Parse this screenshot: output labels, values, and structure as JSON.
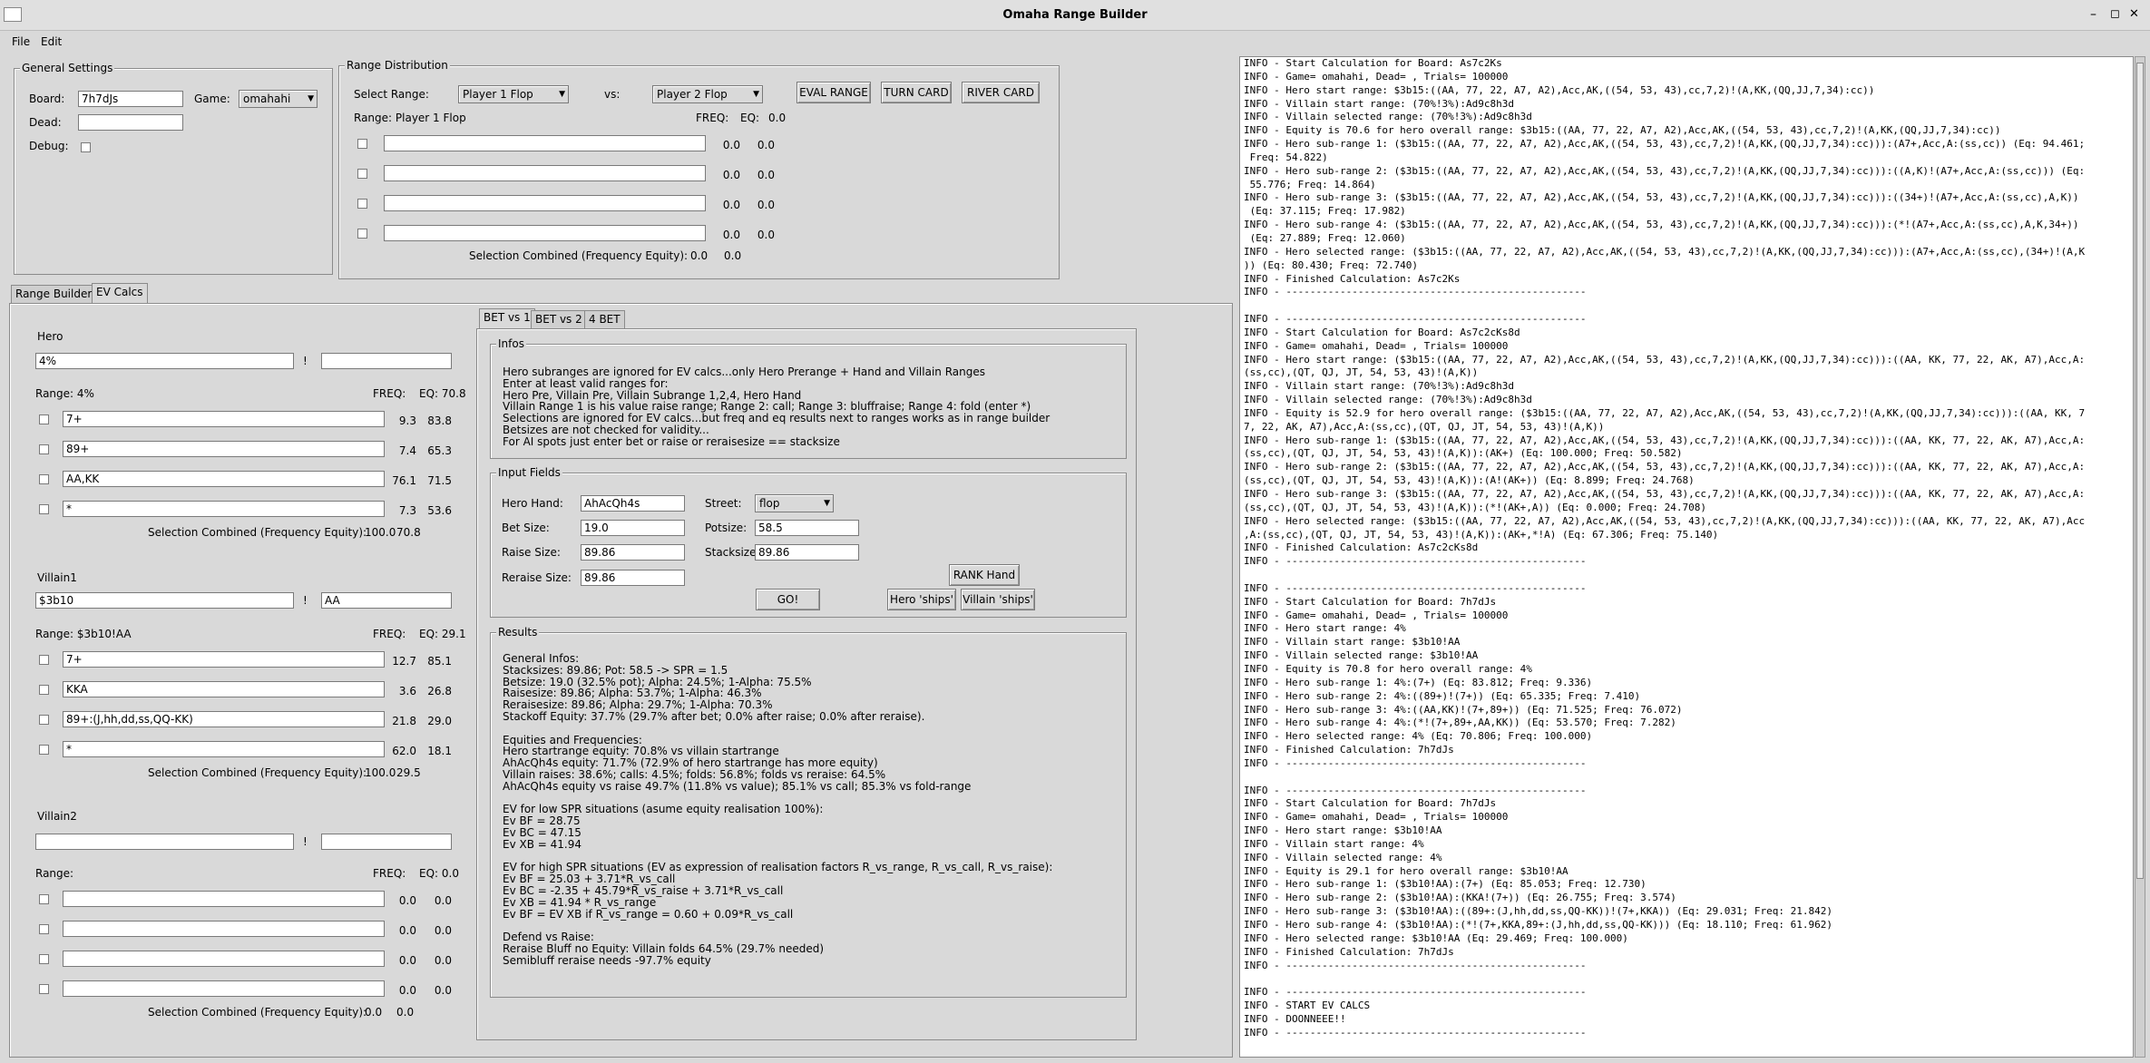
{
  "window": {
    "title": "Omaha Range Builder",
    "minimize": "–",
    "maximize": "◻",
    "close": "✕"
  },
  "menu": {
    "file": "File",
    "edit": "Edit"
  },
  "general": {
    "title": "General Settings",
    "board_label": "Board:",
    "board_value": "7h7dJs",
    "game_label": "Game:",
    "game_value": "omahahi",
    "dead_label": "Dead:",
    "dead_value": "",
    "debug_label": "Debug:"
  },
  "dist": {
    "title": "Range Distribution",
    "select_label": "Select Range:",
    "select_value": "Player 1 Flop",
    "vs_label": "vs:",
    "vs_value": "Player 2 Flop",
    "eval": "EVAL RANGE",
    "turn": "TURN CARD",
    "river": "RIVER CARD",
    "range_label": "Range: Player 1 Flop",
    "freq_label": "FREQ:",
    "eq_label": "EQ:",
    "eq_value": "0.0",
    "rows": [
      {
        "freq": "0.0",
        "eq": "0.0"
      },
      {
        "freq": "0.0",
        "eq": "0.0"
      },
      {
        "freq": "0.0",
        "eq": "0.0"
      },
      {
        "freq": "0.0",
        "eq": "0.0"
      }
    ],
    "combined_label": "Selection Combined (Frequency Equity):",
    "combined_freq": "0.0",
    "combined_eq": "0.0"
  },
  "tabs": {
    "range_builder": "Range Builder",
    "ev_calcs": "EV Calcs"
  },
  "hero": {
    "title": "Hero",
    "range_value": "4%",
    "bang": "!",
    "dead_value": "",
    "range_label": "Range: 4%",
    "freq_label": "FREQ:",
    "eq_label": "EQ: 70.8",
    "rows": [
      {
        "text": "7+",
        "freq": "9.3",
        "eq": "83.8"
      },
      {
        "text": "89+",
        "freq": "7.4",
        "eq": "65.3"
      },
      {
        "text": "AA,KK",
        "freq": "76.1",
        "eq": "71.5"
      },
      {
        "text": "*",
        "freq": "7.3",
        "eq": "53.6"
      }
    ],
    "combined_label": "Selection Combined (Frequency Equity):",
    "combined_freq": "100.0",
    "combined_eq": "70.8"
  },
  "villain1": {
    "title": "Villain1",
    "range_value": "$3b10",
    "bang": "!",
    "dead_value": "AA",
    "range_label": "Range: $3b10!AA",
    "freq_label": "FREQ:",
    "eq_label": "EQ: 29.1",
    "rows": [
      {
        "text": "7+",
        "freq": "12.7",
        "eq": "85.1"
      },
      {
        "text": "KKA",
        "freq": "3.6",
        "eq": "26.8"
      },
      {
        "text": "89+:(J,hh,dd,ss,QQ-KK)",
        "freq": "21.8",
        "eq": "29.0"
      },
      {
        "text": "*",
        "freq": "62.0",
        "eq": "18.1"
      }
    ],
    "combined_label": "Selection Combined (Frequency Equity):",
    "combined_freq": "100.0",
    "combined_eq": "29.5"
  },
  "villain2": {
    "title": "Villain2",
    "range_value": "",
    "bang": "!",
    "dead_value": "",
    "range_label": "Range:",
    "freq_label": "FREQ:",
    "eq_label": "EQ: 0.0",
    "rows": [
      {
        "text": "",
        "freq": "0.0",
        "eq": "0.0"
      },
      {
        "text": "",
        "freq": "0.0",
        "eq": "0.0"
      },
      {
        "text": "",
        "freq": "0.0",
        "eq": "0.0"
      },
      {
        "text": "",
        "freq": "0.0",
        "eq": "0.0"
      }
    ],
    "combined_label": "Selection Combined (Frequency Equity):",
    "combined_freq": "0.0",
    "combined_eq": "0.0"
  },
  "bet_tabs": {
    "bet1": "BET vs 1",
    "bet2": "BET vs 2",
    "bet4": "4 BET"
  },
  "infos": {
    "title": "Infos",
    "lines": [
      "Hero subranges are ignored for EV calcs...only Hero Prerange + Hand and Villain Ranges",
      "Enter at least valid ranges for:",
      "Hero Pre, Villain Pre, Villain Subrange 1,2,4, Hero Hand",
      "Villain Range 1 is his value raise range; Range 2: call; Range 3: bluffraise; Range 4: fold (enter *)",
      "Selections are ignored for EV calcs...but freq and eq results next to ranges works as in range builder",
      "Betsizes are not checked for validity...",
      "For AI spots just enter bet or raise or reraisesize == stacksize"
    ]
  },
  "inputs": {
    "title": "Input Fields",
    "hero_hand_label": "Hero Hand:",
    "hero_hand": "AhAcQh4s",
    "street_label": "Street:",
    "street": "flop",
    "bet_label": "Bet Size:",
    "bet": "19.0",
    "pot_label": "Potsize:",
    "pot": "58.5",
    "raise_label": "Raise Size:",
    "raise": "89.86",
    "stack_label": "Stacksize:",
    "stack": "89.86",
    "reraise_label": "Reraise Size:",
    "reraise": "89.86",
    "rank": "RANK Hand",
    "go": "GO!",
    "hero_ships": "Hero 'ships'",
    "villain_ships": "Villain 'ships'"
  },
  "results": {
    "title": "Results",
    "lines": [
      "General Infos:",
      "Stacksizes: 89.86; Pot: 58.5 -> SPR = 1.5",
      "Betsize: 19.0 (32.5% pot); Alpha: 24.5%; 1-Alpha: 75.5%",
      "Raisesize: 89.86; Alpha: 53.7%; 1-Alpha: 46.3%",
      "Reraisesize: 89.86; Alpha: 29.7%; 1-Alpha: 70.3%",
      "Stackoff Equity: 37.7% (29.7% after bet; 0.0% after raise; 0.0% after reraise).",
      "",
      "Equities and Frequencies:",
      "Hero startrange equity: 70.8% vs villain startrange",
      "AhAcQh4s equity: 71.7% (72.9% of hero startrange has more equity)",
      "Villain raises: 38.6%; calls: 4.5%; folds: 56.8%; folds vs reraise: 64.5%",
      "AhAcQh4s equity vs raise 49.7% (11.8% vs value); 85.1% vs call; 85.3% vs fold-range",
      "",
      "EV for low SPR situations (asume equity realisation 100%):",
      "Ev BF = 28.75",
      "Ev BC = 47.15",
      "Ev XB = 41.94",
      "",
      "EV for high SPR situations (EV as expression of realisation factors R_vs_range, R_vs_call, R_vs_raise):",
      "Ev BF = 25.03 + 3.71*R_vs_call",
      "Ev BC = -2.35 + 45.79*R_vs_raise + 3.71*R_vs_call",
      "Ev XB = 41.94 * R_vs_range",
      "Ev BF = EV XB if R_vs_range = 0.60 + 0.09*R_vs_call",
      "",
      "Defend vs Raise:",
      "Reraise Bluff no Equity: Villain folds 64.5% (29.7% needed)",
      "Semibluff reraise needs -97.7% equity"
    ]
  },
  "log": [
    "INFO - Start Calculation for Board: As7c2Ks",
    "INFO - Game= omahahi, Dead= , Trials= 100000",
    "INFO - Hero start range: $3b15:((AA, 77, 22, A7, A2),Acc,AK,((54, 53, 43),cc,7,2)!(A,KK,(QQ,JJ,7,34):cc))",
    "INFO - Villain start range: (70%!3%):Ad9c8h3d",
    "INFO - Villain selected range: (70%!3%):Ad9c8h3d",
    "INFO - Equity is 70.6 for hero overall range: $3b15:((AA, 77, 22, A7, A2),Acc,AK,((54, 53, 43),cc,7,2)!(A,KK,(QQ,JJ,7,34):cc))",
    "INFO - Hero sub-range 1: ($3b15:((AA, 77, 22, A7, A2),Acc,AK,((54, 53, 43),cc,7,2)!(A,KK,(QQ,JJ,7,34):cc))):(A7+,Acc,A:(ss,cc)) (Eq: 94.461;",
    " Freq: 54.822)",
    "INFO - Hero sub-range 2: ($3b15:((AA, 77, 22, A7, A2),Acc,AK,((54, 53, 43),cc,7,2)!(A,KK,(QQ,JJ,7,34):cc))):((A,K)!(A7+,Acc,A:(ss,cc))) (Eq:",
    " 55.776; Freq: 14.864)",
    "INFO - Hero sub-range 3: ($3b15:((AA, 77, 22, A7, A2),Acc,AK,((54, 53, 43),cc,7,2)!(A,KK,(QQ,JJ,7,34):cc))):((34+)!(A7+,Acc,A:(ss,cc),A,K))",
    " (Eq: 37.115; Freq: 17.982)",
    "INFO - Hero sub-range 4: ($3b15:((AA, 77, 22, A7, A2),Acc,AK,((54, 53, 43),cc,7,2)!(A,KK,(QQ,JJ,7,34):cc))):(*!(A7+,Acc,A:(ss,cc),A,K,34+))",
    " (Eq: 27.889; Freq: 12.060)",
    "INFO - Hero selected range: ($3b15:((AA, 77, 22, A7, A2),Acc,AK,((54, 53, 43),cc,7,2)!(A,KK,(QQ,JJ,7,34):cc))):(A7+,Acc,A:(ss,cc),(34+)!(A,K",
    ")) (Eq: 80.430; Freq: 72.740)",
    "INFO - Finished Calculation: As7c2Ks",
    "INFO - --------------------------------------------------",
    "",
    "INFO - --------------------------------------------------",
    "INFO - Start Calculation for Board: As7c2cKs8d",
    "INFO - Game= omahahi, Dead= , Trials= 100000",
    "INFO - Hero start range: ($3b15:((AA, 77, 22, A7, A2),Acc,AK,((54, 53, 43),cc,7,2)!(A,KK,(QQ,JJ,7,34):cc))):((AA, KK, 77, 22, AK, A7),Acc,A:",
    "(ss,cc),(QT, QJ, JT, 54, 53, 43)!(A,K))",
    "INFO - Villain start range: (70%!3%):Ad9c8h3d",
    "INFO - Villain selected range: (70%!3%):Ad9c8h3d",
    "INFO - Equity is 52.9 for hero overall range: ($3b15:((AA, 77, 22, A7, A2),Acc,AK,((54, 53, 43),cc,7,2)!(A,KK,(QQ,JJ,7,34):cc))):((AA, KK, 7",
    "7, 22, AK, A7),Acc,A:(ss,cc),(QT, QJ, JT, 54, 53, 43)!(A,K))",
    "INFO - Hero sub-range 1: ($3b15:((AA, 77, 22, A7, A2),Acc,AK,((54, 53, 43),cc,7,2)!(A,KK,(QQ,JJ,7,34):cc))):((AA, KK, 77, 22, AK, A7),Acc,A:",
    "(ss,cc),(QT, QJ, JT, 54, 53, 43)!(A,K)):(AK+) (Eq: 100.000; Freq: 50.582)",
    "INFO - Hero sub-range 2: ($3b15:((AA, 77, 22, A7, A2),Acc,AK,((54, 53, 43),cc,7,2)!(A,KK,(QQ,JJ,7,34):cc))):((AA, KK, 77, 22, AK, A7),Acc,A:",
    "(ss,cc),(QT, QJ, JT, 54, 53, 43)!(A,K)):(A!(AK+)) (Eq: 8.899; Freq: 24.768)",
    "INFO - Hero sub-range 3: ($3b15:((AA, 77, 22, A7, A2),Acc,AK,((54, 53, 43),cc,7,2)!(A,KK,(QQ,JJ,7,34):cc))):((AA, KK, 77, 22, AK, A7),Acc,A:",
    "(ss,cc),(QT, QJ, JT, 54, 53, 43)!(A,K)):(*!(AK+,A)) (Eq: 0.000; Freq: 24.708)",
    "INFO - Hero selected range: ($3b15:((AA, 77, 22, A7, A2),Acc,AK,((54, 53, 43),cc,7,2)!(A,KK,(QQ,JJ,7,34):cc))):((AA, KK, 77, 22, AK, A7),Acc",
    ",A:(ss,cc),(QT, QJ, JT, 54, 53, 43)!(A,K)):(AK+,*!A) (Eq: 67.306; Freq: 75.140)",
    "INFO - Finished Calculation: As7c2cKs8d",
    "INFO - --------------------------------------------------",
    "",
    "INFO - --------------------------------------------------",
    "INFO - Start Calculation for Board: 7h7dJs",
    "INFO - Game= omahahi, Dead= , Trials= 100000",
    "INFO - Hero start range: 4%",
    "INFO - Villain start range: $3b10!AA",
    "INFO - Villain selected range: $3b10!AA",
    "INFO - Equity is 70.8 for hero overall range: 4%",
    "INFO - Hero sub-range 1: 4%:(7+) (Eq: 83.812; Freq: 9.336)",
    "INFO - Hero sub-range 2: 4%:((89+)!(7+)) (Eq: 65.335; Freq: 7.410)",
    "INFO - Hero sub-range 3: 4%:((AA,KK)!(7+,89+)) (Eq: 71.525; Freq: 76.072)",
    "INFO - Hero sub-range 4: 4%:(*!(7+,89+,AA,KK)) (Eq: 53.570; Freq: 7.282)",
    "INFO - Hero selected range: 4% (Eq: 70.806; Freq: 100.000)",
    "INFO - Finished Calculation: 7h7dJs",
    "INFO - --------------------------------------------------",
    "",
    "INFO - --------------------------------------------------",
    "INFO - Start Calculation for Board: 7h7dJs",
    "INFO - Game= omahahi, Dead= , Trials= 100000",
    "INFO - Hero start range: $3b10!AA",
    "INFO - Villain start range: 4%",
    "INFO - Villain selected range: 4%",
    "INFO - Equity is 29.1 for hero overall range: $3b10!AA",
    "INFO - Hero sub-range 1: ($3b10!AA):(7+) (Eq: 85.053; Freq: 12.730)",
    "INFO - Hero sub-range 2: ($3b10!AA):(KKA!(7+)) (Eq: 26.755; Freq: 3.574)",
    "INFO - Hero sub-range 3: ($3b10!AA):((89+:(J,hh,dd,ss,QQ-KK))!(7+,KKA)) (Eq: 29.031; Freq: 21.842)",
    "INFO - Hero sub-range 4: ($3b10!AA):(*!(7+,KKA,89+:(J,hh,dd,ss,QQ-KK))) (Eq: 18.110; Freq: 61.962)",
    "INFO - Hero selected range: $3b10!AA (Eq: 29.469; Freq: 100.000)",
    "INFO - Finished Calculation: 7h7dJs",
    "INFO - --------------------------------------------------",
    "",
    "INFO - --------------------------------------------------",
    "INFO - START EV CALCS",
    "INFO - DOONNEEE!!",
    "INFO - --------------------------------------------------"
  ]
}
